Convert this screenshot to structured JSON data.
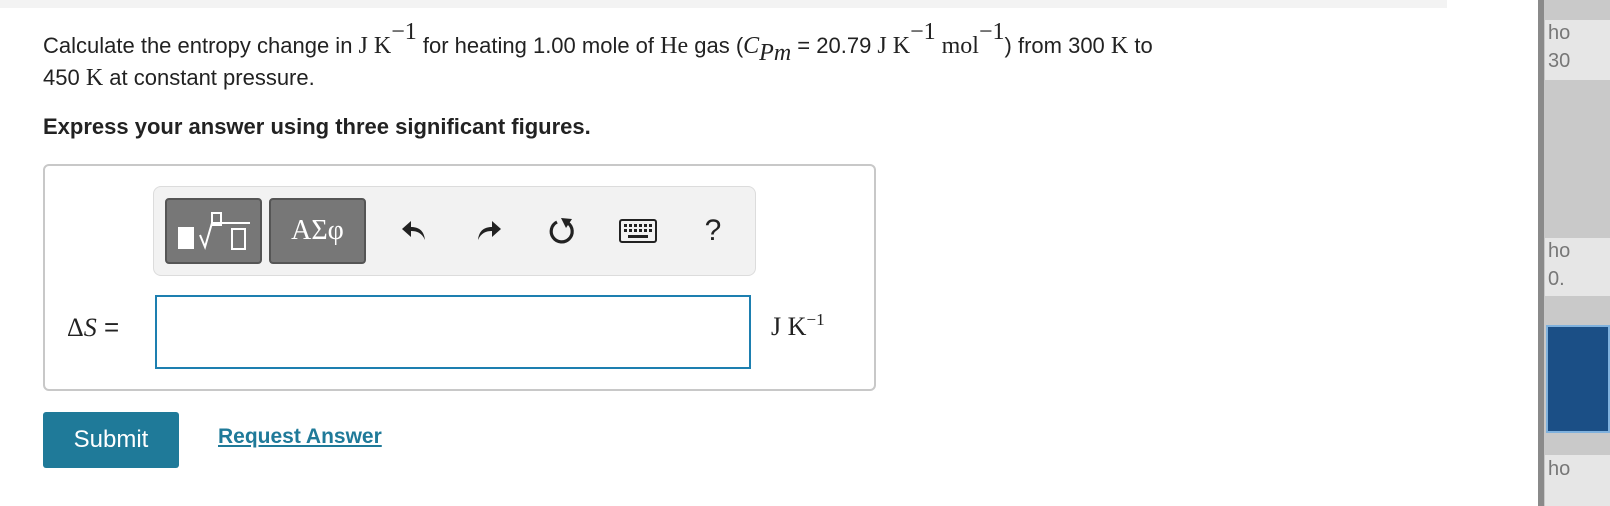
{
  "question": {
    "p1": "Calculate the entropy change in ",
    "unit1": "J K",
    "exp_neg1": "−1",
    "p2": " for heating 1.00 mole of ",
    "he": "He",
    "p3": " gas (",
    "cp_c": "C",
    "cp_sub": "Pm",
    "p4": " = 20.79 ",
    "unit2": "J K",
    "exp2": "−1",
    "mol": " mol",
    "exp3": "−1",
    "p5": ") from 300 ",
    "k1": "K",
    "p6": " to",
    "p7": "450 ",
    "k2": "K",
    "p8": " at constant pressure."
  },
  "instruction": "Express your answer using three significant figures.",
  "toolbar": {
    "symbols_label": "ΑΣφ",
    "help_label": "?"
  },
  "answer": {
    "lhs_delta": "Δ",
    "lhs_var": "S",
    "lhs_eq": " =",
    "input_value": "",
    "unit": "J K",
    "unit_exp": "−1"
  },
  "actions": {
    "submit_label": "Submit",
    "request_label": "Request Answer"
  },
  "side_panel": {
    "t1": "ho",
    "t2": "30",
    "t3": "ho",
    "t4": "0.",
    "t5": "ho"
  },
  "colors": {
    "accent": "#1f7a99",
    "input_border": "#1d7fb0",
    "toolbar_button": "#777777"
  },
  "icons": [
    "templates-icon",
    "undo-icon",
    "redo-icon",
    "reset-icon",
    "keyboard-icon",
    "help-icon"
  ]
}
